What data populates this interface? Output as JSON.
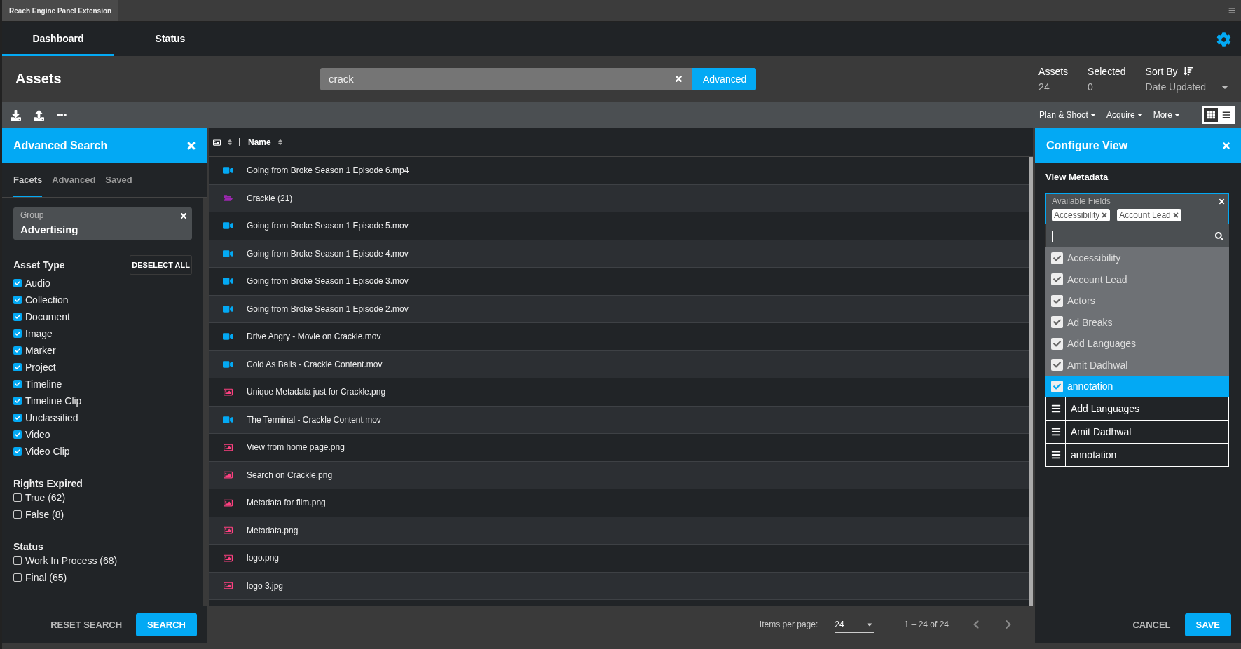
{
  "window": {
    "title": "Reach Engine Panel Extension"
  },
  "nav_tabs": [
    {
      "label": "Dashboard",
      "selected": true
    },
    {
      "label": "Status",
      "selected": false
    }
  ],
  "header": {
    "title": "Assets",
    "search": {
      "value": "crack"
    },
    "advanced_button": "Advanced",
    "stats": [
      {
        "label": "Assets",
        "value": "24"
      },
      {
        "label": "Selected",
        "value": "0"
      }
    ],
    "sort": {
      "label": "Sort By",
      "value": "Date Updated"
    }
  },
  "toolbar": {
    "menus": [
      "Plan & Shoot",
      "Acquire",
      "More"
    ],
    "view_modes": [
      {
        "kind": "grid",
        "selected": true
      },
      {
        "kind": "list",
        "selected": false
      }
    ]
  },
  "advanced_search": {
    "title": "Advanced Search",
    "tabs": [
      {
        "label": "Facets",
        "selected": true
      },
      {
        "label": "Advanced",
        "selected": false
      },
      {
        "label": "Saved",
        "selected": false
      }
    ],
    "group_chip": {
      "label": "Group",
      "value": "Advertising"
    },
    "deselect_all": "DESELECT ALL",
    "sections": [
      {
        "title": "Asset Type",
        "items": [
          {
            "label": "Audio",
            "checked": true
          },
          {
            "label": "Collection",
            "checked": true
          },
          {
            "label": "Document",
            "checked": true
          },
          {
            "label": "Image",
            "checked": true
          },
          {
            "label": "Marker",
            "checked": true
          },
          {
            "label": "Project",
            "checked": true
          },
          {
            "label": "Timeline",
            "checked": true
          },
          {
            "label": "Timeline Clip",
            "checked": true
          },
          {
            "label": "Unclassified",
            "checked": true
          },
          {
            "label": "Video",
            "checked": true
          },
          {
            "label": "Video Clip",
            "checked": true
          }
        ]
      },
      {
        "title": "Rights Expired",
        "items": [
          {
            "label": "True (62)",
            "checked": false
          },
          {
            "label": "False (8)",
            "checked": false
          }
        ]
      },
      {
        "title": "Status",
        "items": [
          {
            "label": "Work In Process (68)",
            "checked": false
          },
          {
            "label": "Final (65)",
            "checked": false
          }
        ]
      }
    ],
    "buttons": [
      "RESET SEARCH",
      "SEARCH"
    ]
  },
  "table": {
    "columns": [
      "Name"
    ],
    "rows": [
      {
        "kind": "video",
        "name": "Going from Broke Season 1 Episode 6.mp4"
      },
      {
        "kind": "folder",
        "name": "Crackle (21)"
      },
      {
        "kind": "video",
        "name": "Going from Broke Season 1 Episode 5.mov"
      },
      {
        "kind": "video",
        "name": "Going from Broke Season 1 Episode 4.mov"
      },
      {
        "kind": "video",
        "name": "Going from Broke Season 1 Episode 3.mov"
      },
      {
        "kind": "video",
        "name": "Going from Broke Season 1 Episode 2.mov"
      },
      {
        "kind": "video",
        "name": "Drive Angry - Movie on Crackle.mov"
      },
      {
        "kind": "video",
        "name": "Cold As Balls - Crackle Content.mov"
      },
      {
        "kind": "image",
        "name": "Unique Metadata just for Crackle.png"
      },
      {
        "kind": "video",
        "name": "The Terminal - Crackle Content.mov"
      },
      {
        "kind": "image",
        "name": "View from home page.png"
      },
      {
        "kind": "image",
        "name": "Search on Crackle.png"
      },
      {
        "kind": "image",
        "name": "Metadata for film.png"
      },
      {
        "kind": "image",
        "name": "Metadata.png"
      },
      {
        "kind": "image",
        "name": "logo.png"
      },
      {
        "kind": "image",
        "name": "logo 3.jpg"
      }
    ],
    "pagination": {
      "label": "Items per page:",
      "per_page": "24",
      "range": "1 – 24 of 24"
    }
  },
  "configure_view": {
    "title": "Configure View",
    "section": "View Metadata",
    "fields_label": "Available Fields",
    "chips": [
      "Accessibility",
      "Account Lead"
    ],
    "options": [
      {
        "label": "Accessibility",
        "checked": true,
        "selected": false
      },
      {
        "label": "Account Lead",
        "checked": true,
        "selected": false
      },
      {
        "label": "Actors",
        "checked": true,
        "selected": false
      },
      {
        "label": "Ad Breaks",
        "checked": true,
        "selected": false
      },
      {
        "label": "Add Languages",
        "checked": true,
        "selected": false
      },
      {
        "label": "Amit Dadhwal",
        "checked": true,
        "selected": false
      },
      {
        "label": "annotation",
        "checked": true,
        "selected": true
      }
    ],
    "ordered_fields": [
      "Add Languages",
      "Amit Dadhwal",
      "annotation"
    ],
    "buttons": [
      "CANCEL",
      "SAVE"
    ]
  }
}
